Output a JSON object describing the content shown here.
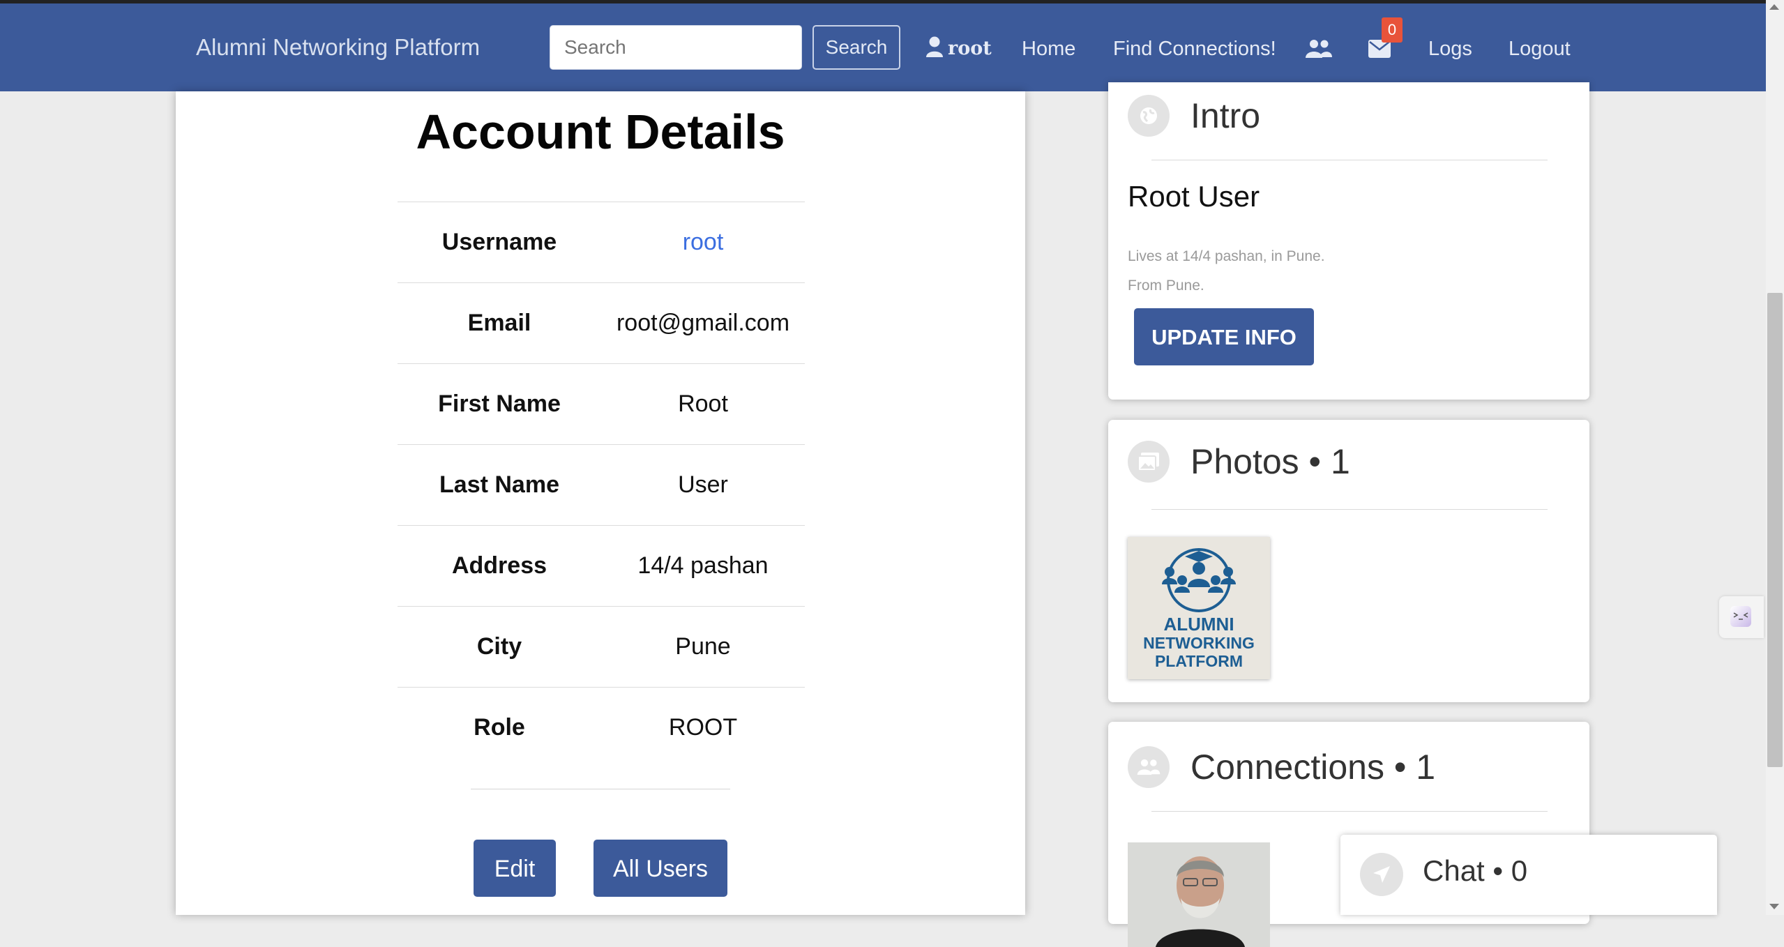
{
  "navbar": {
    "brand": "Alumni Networking Platform",
    "search_placeholder": "Search",
    "search_button": "Search",
    "username": "root",
    "home": "Home",
    "find_connections": "Find Connections!",
    "messages_badge": "0",
    "logs": "Logs",
    "logout": "Logout",
    "color": "#3c5a9a",
    "icons": [
      "user-icon",
      "users-icon",
      "envelope-icon"
    ]
  },
  "account": {
    "title": "Account Details",
    "rows": [
      {
        "label": "Username",
        "value": "root"
      },
      {
        "label": "Email",
        "value": "root@gmail.com"
      },
      {
        "label": "First Name",
        "value": "Root"
      },
      {
        "label": "Last Name",
        "value": "User"
      },
      {
        "label": "Address",
        "value": "14/4 pashan"
      },
      {
        "label": "City",
        "value": "Pune"
      },
      {
        "label": "Role",
        "value": "ROOT"
      }
    ],
    "edit_button": "Edit",
    "all_users_button": "All Users"
  },
  "intro": {
    "title": "Intro",
    "name": "Root User",
    "lives": "Lives at 14/4 pashan, in Pune.",
    "from": "From Pune.",
    "update_button": "UPDATE INFO"
  },
  "photos": {
    "title": "Photos • 1",
    "logo_lines": [
      "ALUMNI",
      "NETWORKING",
      "PLATFORM"
    ]
  },
  "connections": {
    "title": "Connections • 1"
  },
  "chat": {
    "title": "Chat • 0"
  }
}
